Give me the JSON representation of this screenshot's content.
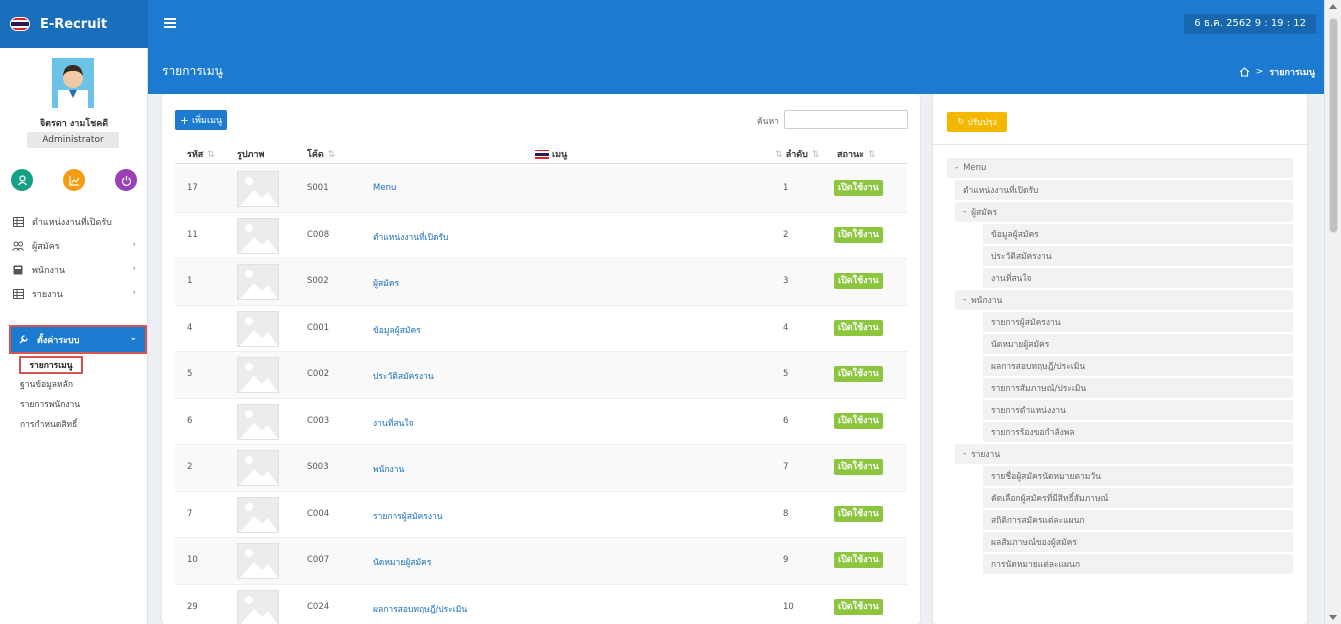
{
  "app": {
    "title": "E-Recruit",
    "clock": "6 ธ.ค. 2562  9 : 19 : 12"
  },
  "user": {
    "name": "จิตรดา งามโชคดี",
    "role": "Administrator"
  },
  "sidebar": {
    "items": [
      {
        "label": "ตำแหน่งงานที่เปิดรับ",
        "icon": "table-icon",
        "has_children": false
      },
      {
        "label": "ผู้สมัคร",
        "icon": "users-icon",
        "has_children": true
      },
      {
        "label": "พนักงาน",
        "icon": "id-card-icon",
        "has_children": true
      },
      {
        "label": "รายงาน",
        "icon": "report-icon",
        "has_children": true
      }
    ],
    "active": {
      "label": "ตั้งค่าระบบ",
      "icon": "wrench-icon"
    },
    "subitems": [
      "รายการเมนู",
      "ฐานข้อมูลหลัก",
      "รายการพนักงาน",
      "การกำหนดสิทธิ์"
    ]
  },
  "page": {
    "title": "รายการเมนู",
    "breadcrumb_current": "รายการเมนู"
  },
  "toolbar": {
    "add_label": "เพิ่มเมนู",
    "search_label": "ค้นหา",
    "search_value": ""
  },
  "table": {
    "headers": {
      "id": "รหัส",
      "image": "รูปภาพ",
      "code": "โค้ด",
      "menu": "เมนู",
      "order": "ลำดับ",
      "status": "สถานะ"
    },
    "rows": [
      {
        "id": "17",
        "code": "S001",
        "menu": "Menu",
        "order": "1",
        "status": "เปิดใช้งาน"
      },
      {
        "id": "11",
        "code": "C008",
        "menu": "ตำแหน่งงานที่เปิดรับ",
        "order": "2",
        "status": "เปิดใช้งาน"
      },
      {
        "id": "1",
        "code": "S002",
        "menu": "ผู้สมัคร",
        "order": "3",
        "status": "เปิดใช้งาน"
      },
      {
        "id": "4",
        "code": "C001",
        "menu": "ข้อมูลผู้สมัคร",
        "order": "4",
        "status": "เปิดใช้งาน"
      },
      {
        "id": "5",
        "code": "C002",
        "menu": "ประวัติสมัครงาน",
        "order": "5",
        "status": "เปิดใช้งาน"
      },
      {
        "id": "6",
        "code": "C003",
        "menu": "งานที่สนใจ",
        "order": "6",
        "status": "เปิดใช้งาน"
      },
      {
        "id": "2",
        "code": "S003",
        "menu": "พนักงาน",
        "order": "7",
        "status": "เปิดใช้งาน"
      },
      {
        "id": "7",
        "code": "C004",
        "menu": "รายการผู้สมัครงาน",
        "order": "8",
        "status": "เปิดใช้งาน"
      },
      {
        "id": "10",
        "code": "C007",
        "menu": "นัดหมายผู้สมัคร",
        "order": "9",
        "status": "เปิดใช้งาน"
      },
      {
        "id": "29",
        "code": "C024",
        "menu": "ผลการสอบทฤษฎี/ประเมิน",
        "order": "10",
        "status": "เปิดใช้งาน"
      }
    ]
  },
  "tree": {
    "update_label": "ปรับปรุง",
    "items": [
      {
        "label": "Menu",
        "level": 0,
        "expander": "-"
      },
      {
        "label": "ตำแหน่งงานที่เปิดรับ",
        "level": 1,
        "expander": ""
      },
      {
        "label": "ผู้สมัคร",
        "level": 1,
        "expander": "-"
      },
      {
        "label": "ข้อมูลผู้สมัคร",
        "level": 2,
        "expander": ""
      },
      {
        "label": "ประวัติสมัครงาน",
        "level": 2,
        "expander": ""
      },
      {
        "label": "งานที่สนใจ",
        "level": 2,
        "expander": ""
      },
      {
        "label": "พนักงาน",
        "level": 1,
        "expander": "-"
      },
      {
        "label": "รายการผู้สมัครงาน",
        "level": 2,
        "expander": ""
      },
      {
        "label": "นัดหมายผู้สมัคร",
        "level": 2,
        "expander": ""
      },
      {
        "label": "ผลการสอบทฤษฎี/ประเมิน",
        "level": 2,
        "expander": ""
      },
      {
        "label": "รายการสัมภาษณ์/ประเมิน",
        "level": 2,
        "expander": ""
      },
      {
        "label": "รายการตำแหน่งงาน",
        "level": 2,
        "expander": ""
      },
      {
        "label": "รายการร้องขอกำลังพล",
        "level": 2,
        "expander": ""
      },
      {
        "label": "รายงาน",
        "level": 1,
        "expander": "-"
      },
      {
        "label": "รายชื่อผู้สมัครนัดหมายตามวัน",
        "level": 2,
        "expander": ""
      },
      {
        "label": "คัดเลือกผู้สมัครที่มีสิทธิ์สัมภาษณ์",
        "level": 2,
        "expander": ""
      },
      {
        "label": "สถิติการสมัครแต่ละแผนก",
        "level": 2,
        "expander": ""
      },
      {
        "label": "ผลสัมภาษณ์ของผู้สมัคร",
        "level": 2,
        "expander": ""
      },
      {
        "label": "การนัดหมายแต่ละแผนก",
        "level": 2,
        "expander": ""
      }
    ]
  },
  "colors": {
    "primary": "#1c7bd0",
    "status_green": "#8cc63f",
    "update_yellow": "#f5b800",
    "highlight_red": "#d9534f"
  }
}
